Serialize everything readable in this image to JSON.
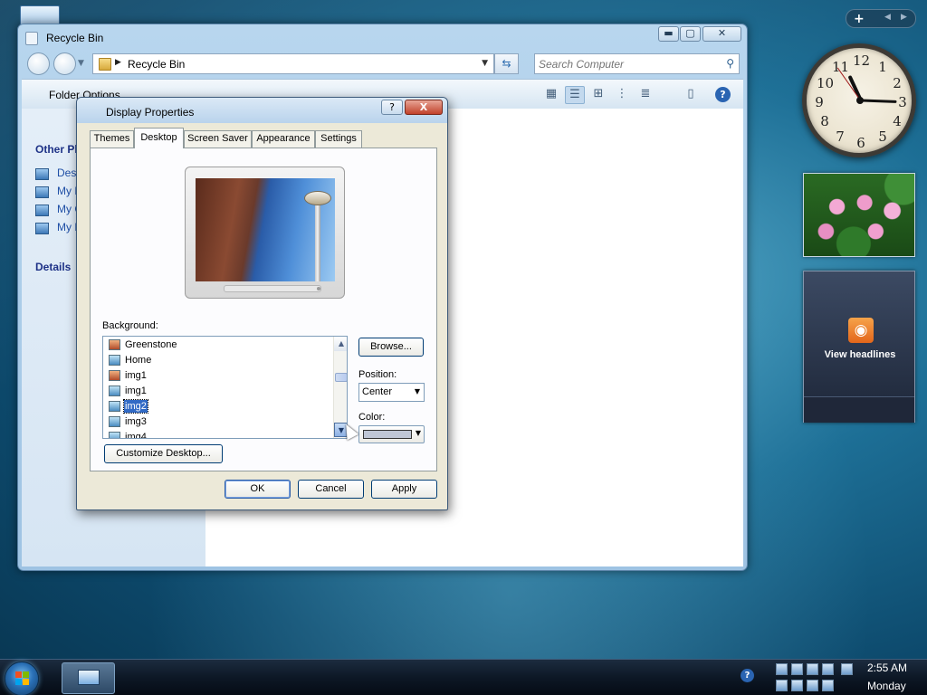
{
  "explorer": {
    "title": "Recycle Bin",
    "address": "Recycle Bin",
    "search_placeholder": "Search Computer",
    "command_folder_options": "Folder Options",
    "nav_section_other_places": "Other Pla",
    "nav_links": [
      "Deskt",
      "My D",
      "My C",
      "My N"
    ],
    "nav_section_details": "Details"
  },
  "dialog": {
    "title": "Display Properties",
    "help_glyph": "?",
    "close_glyph": "X",
    "tabs": [
      "Themes",
      "Desktop",
      "Screen Saver",
      "Appearance",
      "Settings"
    ],
    "active_tab": "Desktop",
    "background_label": "Background:",
    "background_items": [
      "Greenstone",
      "Home",
      "img1",
      "img1",
      "img2",
      "img3",
      "img4"
    ],
    "selected_background": "img2",
    "browse_label": "Browse...",
    "position_label": "Position:",
    "position_value": "Center",
    "color_label": "Color:",
    "color_value": "#c0c7d6",
    "customize_label": "Customize Desktop...",
    "ok_label": "OK",
    "cancel_label": "Cancel",
    "apply_label": "Apply"
  },
  "sidebar": {
    "add_glyph": "+",
    "clock_numbers": [
      "12",
      "1",
      "2",
      "3",
      "4",
      "5",
      "6",
      "7",
      "8",
      "9",
      "10",
      "11"
    ],
    "feed_label": "View headlines"
  },
  "taskbar": {
    "time": "2:55 AM",
    "day": "Monday"
  },
  "colors": {
    "accent": "#316ac5",
    "close_red": "#c1412a",
    "rss_orange": "#e3661b"
  }
}
